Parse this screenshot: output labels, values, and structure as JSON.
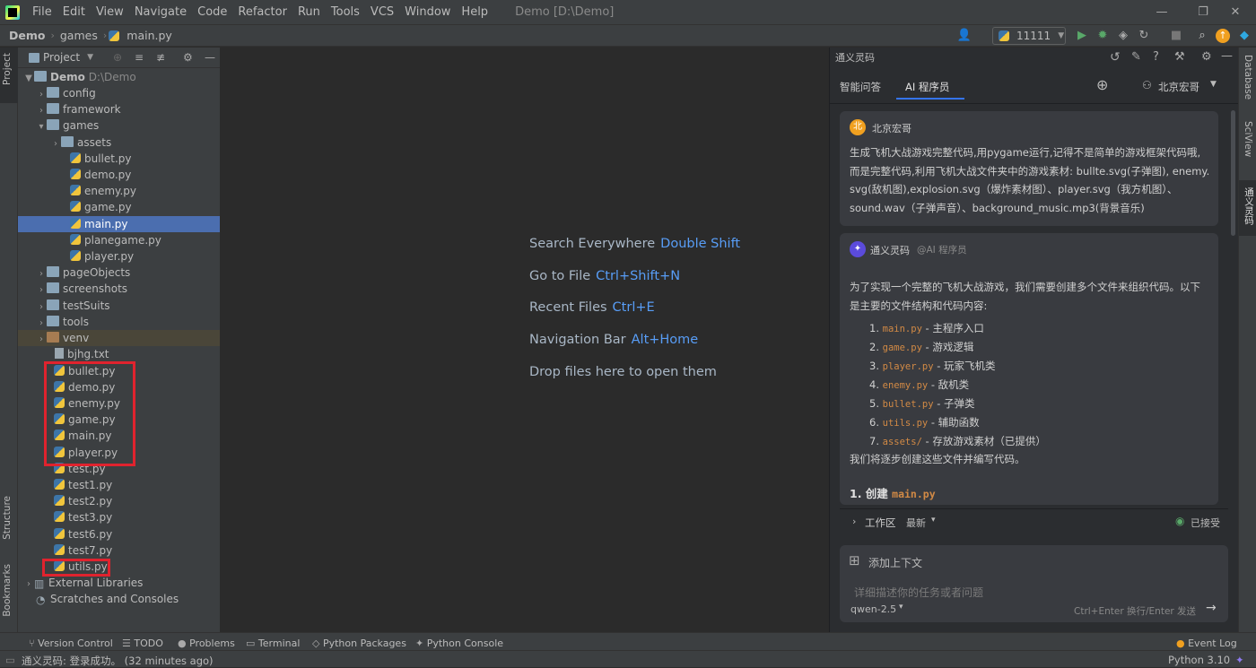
{
  "menubar": {
    "items": [
      "File",
      "Edit",
      "View",
      "Navigate",
      "Code",
      "Refactor",
      "Run",
      "Tools",
      "VCS",
      "Window",
      "Help"
    ],
    "title": "Demo [D:\\Demo]"
  },
  "navbar": {
    "breadcrumbs": [
      "Demo",
      "games",
      "main.py"
    ],
    "run_config": "11111"
  },
  "left_strip": {
    "project": "Project",
    "structure": "Structure",
    "bookmarks": "Bookmarks"
  },
  "right_strip": {
    "database": "Database",
    "sciview": "SciView",
    "tongyi": "通义灵码"
  },
  "project": {
    "header": "Project",
    "root_name": "Demo",
    "root_path": "D:\\Demo",
    "tree": [
      "config",
      "framework",
      "games",
      "assets",
      "bullet.py",
      "demo.py",
      "enemy.py",
      "game.py",
      "main.py",
      "planegame.py",
      "player.py",
      "pageObjects",
      "screenshots",
      "testSuits",
      "tools",
      "venv",
      "bjhg.txt",
      "bullet.py",
      "demo.py",
      "enemy.py",
      "game.py",
      "main.py",
      "player.py",
      "test.py",
      "test1.py",
      "test2.py",
      "test3.py",
      "test6.py",
      "test7.py",
      "utils.py",
      "External Libraries",
      "Scratches and Consoles"
    ]
  },
  "editor": {
    "hints": [
      {
        "label": "Search Everywhere",
        "key": "Double Shift"
      },
      {
        "label": "Go to File",
        "key": "Ctrl+Shift+N"
      },
      {
        "label": "Recent Files",
        "key": "Ctrl+E"
      },
      {
        "label": "Navigation Bar",
        "key": "Alt+Home"
      },
      {
        "label": "Drop files here to open them",
        "key": ""
      }
    ]
  },
  "ai": {
    "title": "通义灵码",
    "tabs": [
      "智能问答",
      "AI 程序员"
    ],
    "user": "北京宏哥",
    "user_avatar": "北",
    "user_message": [
      "生成飞机大战游戏完整代码,用pygame运行,记得不是简单的游戏框架代码哦,",
      "而是完整代码,利用飞机大战文件夹中的游戏素材: bullte.svg(子弹图), enemy.",
      "svg(敌机图),explosion.svg（爆炸素材图）、player.svg（我方机图）、",
      "sound.wav（子弹声音）、background_music.mp3(背景音乐)"
    ],
    "bot_name": "通义灵码",
    "bot_role": "@AI 程序员",
    "bot_intro": [
      "为了实现一个完整的飞机大战游戏，我们需要创建多个文件来组织代码。以下",
      "是主要的文件结构和代码内容:"
    ],
    "bot_list": [
      {
        "n": "1.",
        "code": "main.py",
        "desc": " - 主程序入口"
      },
      {
        "n": "2.",
        "code": "game.py",
        "desc": " - 游戏逻辑"
      },
      {
        "n": "3.",
        "code": "player.py",
        "desc": " - 玩家飞机类"
      },
      {
        "n": "4.",
        "code": "enemy.py",
        "desc": " - 敌机类"
      },
      {
        "n": "5.",
        "code": "bullet.py",
        "desc": " - 子弹类"
      },
      {
        "n": "6.",
        "code": "utils.py",
        "desc": " - 辅助函数"
      },
      {
        "n": "7.",
        "code": "assets/",
        "desc": " - 存放游戏素材（已提供）"
      }
    ],
    "bot_outro": "我们将逐步创建这些文件并编写代码。",
    "section_prefix": "1. 创建 ",
    "section_code": "main.py",
    "workspace": "工作区",
    "workspace_filter": "最新",
    "accepted": "已接受",
    "add_context": "添加上下文",
    "input_placeholder": "详细描述你的任务或者问题",
    "model": "qwen-2.5",
    "send_hint": "Ctrl+Enter 换行/Enter 发送"
  },
  "bottom_tabs": [
    "Version Control",
    "TODO",
    "Problems",
    "Terminal",
    "Python Packages",
    "Python Console"
  ],
  "event_log": "Event Log",
  "status": {
    "message": "通义灵码: 登录成功。 (32 minutes ago)",
    "interpreter": "Python 3.10"
  }
}
